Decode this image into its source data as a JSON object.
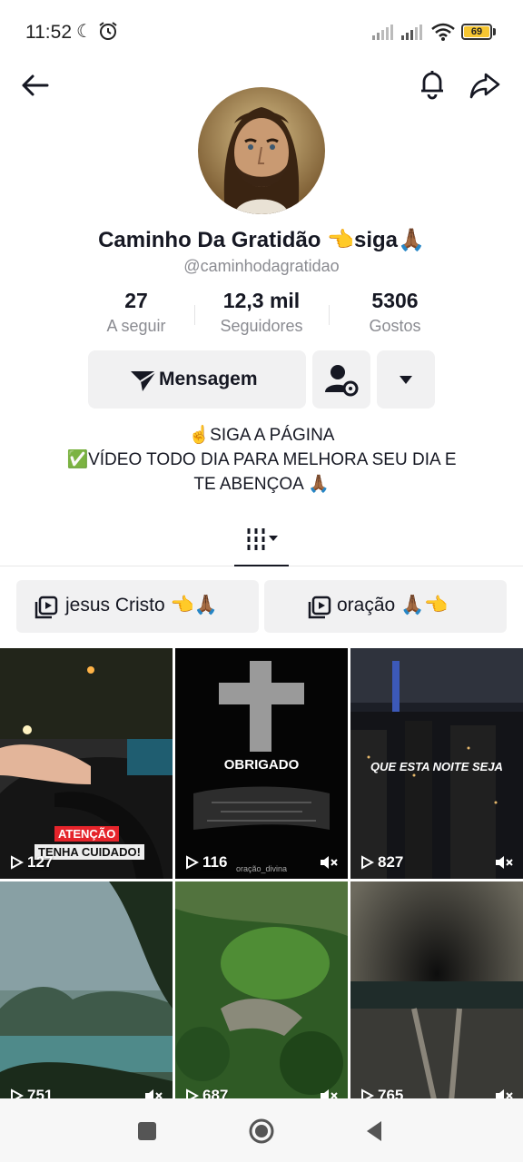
{
  "status_bar": {
    "time": "11:52",
    "battery": "69",
    "battery_color": "#f6c631"
  },
  "nav": {
    "back_icon": "arrow-left-icon",
    "bell_icon": "bell-icon",
    "share_icon": "share-icon"
  },
  "profile": {
    "display_name": "Caminho Da Gratidão 👈siga🙏🏾",
    "username": "@caminhodagratidao",
    "stats": [
      {
        "value": "27",
        "label": "A seguir"
      },
      {
        "value": "12,3 mil",
        "label": "Seguidores"
      },
      {
        "value": "5306",
        "label": "Gostos"
      }
    ],
    "buttons": {
      "message_label": "Mensagem"
    },
    "bio": {
      "line1": "☝️SIGA A PÁGINA",
      "line2": "✅VÍDEO TODO DIA PARA MELHORA SEU DIA E",
      "line3": "TE ABENÇOA 🙏🏾"
    }
  },
  "playlists": [
    {
      "label": "jesus Cristo 👈🙏🏾"
    },
    {
      "label": "oração 🙏🏾👈"
    }
  ],
  "videos": [
    {
      "views": "127",
      "overlay_top": "ATENÇÃO",
      "overlay_bottom": "TENHA CUIDADO!",
      "muted": false
    },
    {
      "views": "116",
      "overlay": "OBRIGADO",
      "watermark": "oração_divina",
      "muted": true
    },
    {
      "views": "827",
      "overlay": "QUE ESTA NOITE SEJA",
      "muted": true
    },
    {
      "views": "751",
      "muted": true
    },
    {
      "views": "687",
      "muted": true
    },
    {
      "views": "765",
      "muted": true
    }
  ]
}
